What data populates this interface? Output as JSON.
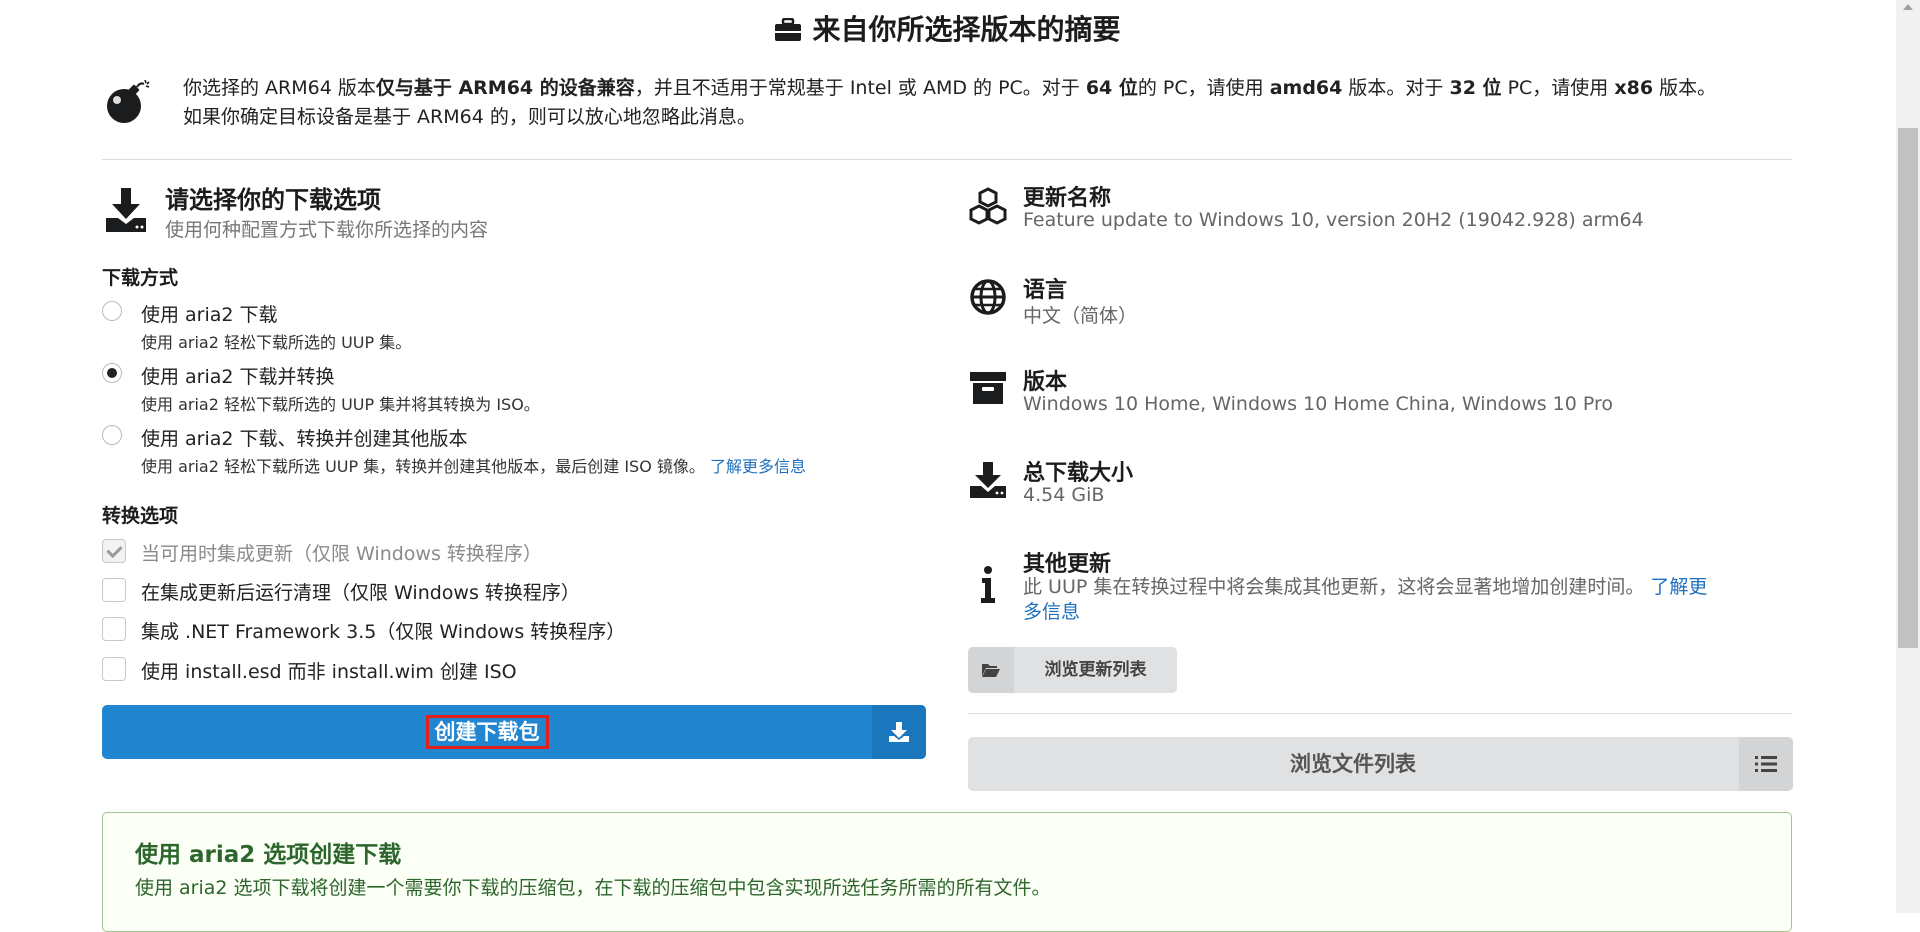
{
  "header": {
    "title": "来自你所选择版本的摘要",
    "icon": "briefcase-icon"
  },
  "warning": {
    "icon": "bomb-icon",
    "line1": [
      {
        "t": "你选择的 ARM64 版本",
        "b": false
      },
      {
        "t": "仅与基于 ARM64 的设备兼容",
        "b": true
      },
      {
        "t": "，并且不适用于常规基于 Intel 或 AMD 的 PC。对于 ",
        "b": false
      },
      {
        "t": "64 位",
        "b": true
      },
      {
        "t": "的 PC，请使用 ",
        "b": false
      },
      {
        "t": "amd64",
        "b": true
      },
      {
        "t": " 版本。对于 ",
        "b": false
      },
      {
        "t": "32 位",
        "b": true
      },
      {
        "t": " PC，请使用 ",
        "b": false
      },
      {
        "t": "x86",
        "b": true
      },
      {
        "t": " 版本。",
        "b": false
      }
    ],
    "line2": "如果你确定目标设备是基于 ARM64 的，则可以放心地忽略此消息。"
  },
  "download_section": {
    "icon": "download-tray-icon",
    "title": "请选择你的下载选项",
    "subtitle": "使用何种配置方式下载你所选择的内容",
    "method_label": "下载方式",
    "options": [
      {
        "label": "使用 aria2 下载",
        "desc": "使用 aria2 轻松下载所选的 UUP 集。",
        "selected": false
      },
      {
        "label": "使用 aria2 下载并转换",
        "desc": "使用 aria2 轻松下载所选的 UUP 集并将其转换为 ISO。",
        "selected": true
      },
      {
        "label": "使用 aria2 下载、转换并创建其他版本",
        "desc": "使用 aria2 轻松下载所选 UUP 集，转换并创建其他版本，最后创建 ISO 镜像。",
        "link": "了解更多信息",
        "selected": false
      }
    ],
    "conversion_label": "转换选项",
    "checks": [
      {
        "label": "当可用时集成更新（仅限 Windows 转换程序）",
        "checked": true,
        "disabled": true
      },
      {
        "label": "在集成更新后运行清理（仅限 Windows 转换程序）",
        "checked": false
      },
      {
        "label": "集成 .NET Framework 3.5（仅限 Windows 转换程序）",
        "checked": false
      },
      {
        "label": "使用 install.esd 而非 install.wim 创建 ISO",
        "checked": false
      }
    ],
    "create_button": "创建下载包"
  },
  "info": {
    "update_name": {
      "title": "更新名称",
      "value": "Feature update to Windows 10, version 20H2 (19042.928) arm64",
      "icon": "cubes-icon"
    },
    "language": {
      "title": "语言",
      "value": "中文（简体）",
      "icon": "globe-icon"
    },
    "edition": {
      "title": "版本",
      "value": "Windows 10 Home, Windows 10 Home China, Windows 10 Pro",
      "icon": "archive-icon"
    },
    "size": {
      "title": "总下载大小",
      "value": "4.54 GiB",
      "icon": "download-icon"
    },
    "additional": {
      "title": "其他更新",
      "value1": "此 UUP 集在转换过程中将会集成其他更新，这将会显著地增加创建时间。",
      "link1": "了解更",
      "link2": "多信息",
      "icon": "info-icon"
    },
    "browse_updates": "浏览更新列表",
    "browse_files": "浏览文件列表"
  },
  "success": {
    "title": "使用 aria2 选项创建下载",
    "text": "使用 aria2 选项下载将创建一个需要你下载的压缩包，在下载的压缩包中包含实现所选任务所需的所有文件。"
  },
  "colors": {
    "primary": "#2185d0",
    "link": "#1e70bf",
    "success": "#2c662d",
    "highlight": "#e0201b"
  }
}
